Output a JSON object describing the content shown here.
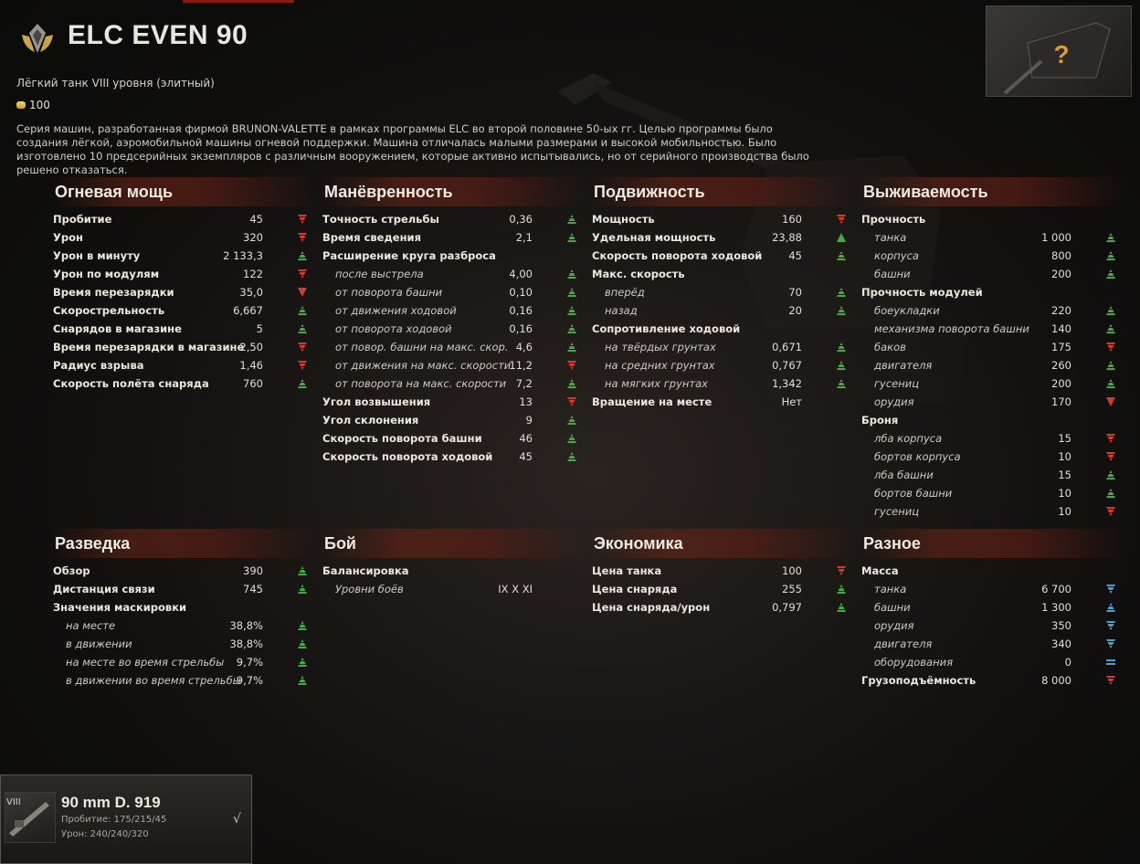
{
  "header": {
    "tank_name": "ELC EVEN 90",
    "tank_class": "Лёгкий танк VIII уровня (элитный)",
    "price": "100",
    "description": "Серия машин, разработанная фирмой BRUNON-VALETTE в рамках программы ELC во второй половине 50-ых гг. Целью программы было создания лёгкой, аэромобильной машины огневой поддержки. Машина отличалась малыми размерами и высокой мобильностью. Было изготовлено 10 предсерийных экземпляров с различным вооружением, которые активно испытывались, но от серийного производства было решено отказаться."
  },
  "sections": [
    {
      "title": "Огневая мощь",
      "rows": [
        {
          "label": "Пробитие",
          "value": "45",
          "ind": "down"
        },
        {
          "label": "Урон",
          "value": "320",
          "ind": "down"
        },
        {
          "label": "Урон в минуту",
          "value": "2 133,3",
          "ind": "up"
        },
        {
          "label": "Урон по модулям",
          "value": "122",
          "ind": "down"
        },
        {
          "label": "Время перезарядки",
          "value": "35,0",
          "ind": "downsolid"
        },
        {
          "label": "Скорострельность",
          "value": "6,667",
          "ind": "up"
        },
        {
          "label": "Снарядов в магазине",
          "value": "5",
          "ind": "up"
        },
        {
          "label": "Время перезарядки в магазине",
          "value": "2,50",
          "ind": "down"
        },
        {
          "label": "Радиус взрыва",
          "value": "1,46",
          "ind": "down"
        },
        {
          "label": "Скорость полёта снаряда",
          "value": "760",
          "ind": "up"
        }
      ]
    },
    {
      "title": "Манёвренность",
      "rows": [
        {
          "label": "Точность стрельбы",
          "value": "0,36",
          "ind": "up"
        },
        {
          "label": "Время сведения",
          "value": "2,1",
          "ind": "up"
        },
        {
          "label": "Расширение круга разброса",
          "value": "",
          "ind": ""
        },
        {
          "label": "после выстрела",
          "value": "4,00",
          "ind": "up",
          "sub": true
        },
        {
          "label": "от поворота башни",
          "value": "0,10",
          "ind": "up",
          "sub": true
        },
        {
          "label": "от движения ходовой",
          "value": "0,16",
          "ind": "up",
          "sub": true
        },
        {
          "label": "от поворота ходовой",
          "value": "0,16",
          "ind": "up",
          "sub": true
        },
        {
          "label": "от повор. башни на макс. скор.",
          "value": "4,6",
          "ind": "up",
          "sub": true
        },
        {
          "label": "от движения на макс. скорости",
          "value": "11,2",
          "ind": "down",
          "sub": true
        },
        {
          "label": "от поворота на макс. скорости",
          "value": "7,2",
          "ind": "up",
          "sub": true
        },
        {
          "label": "Угол возвышения",
          "value": "13",
          "ind": "down"
        },
        {
          "label": "Угол склонения",
          "value": "9",
          "ind": "up"
        },
        {
          "label": "Скорость поворота башни",
          "value": "46",
          "ind": "up"
        },
        {
          "label": "Скорость поворота ходовой",
          "value": "45",
          "ind": "up"
        }
      ]
    },
    {
      "title": "Подвижность",
      "rows": [
        {
          "label": "Мощность",
          "value": "160",
          "ind": "down"
        },
        {
          "label": "Удельная мощность",
          "value": "23,88",
          "ind": "upsolid"
        },
        {
          "label": "Скорость поворота ходовой",
          "value": "45",
          "ind": "up"
        },
        {
          "label": "Макс. скорость",
          "value": "",
          "ind": ""
        },
        {
          "label": "вперёд",
          "value": "70",
          "ind": "up",
          "sub": true
        },
        {
          "label": "назад",
          "value": "20",
          "ind": "up",
          "sub": true
        },
        {
          "label": "Сопротивление ходовой",
          "value": "",
          "ind": ""
        },
        {
          "label": "на твёрдых грунтах",
          "value": "0,671",
          "ind": "up",
          "sub": true
        },
        {
          "label": "на средних грунтах",
          "value": "0,767",
          "ind": "up",
          "sub": true
        },
        {
          "label": "на мягких грунтах",
          "value": "1,342",
          "ind": "up",
          "sub": true
        },
        {
          "label": "Вращение на месте",
          "value": "Нет",
          "ind": ""
        }
      ]
    },
    {
      "title": "Выживаемость",
      "rows": [
        {
          "label": "Прочность",
          "value": "",
          "ind": ""
        },
        {
          "label": "танка",
          "value": "1 000",
          "ind": "up",
          "sub": true
        },
        {
          "label": "корпуса",
          "value": "800",
          "ind": "up",
          "sub": true
        },
        {
          "label": "башни",
          "value": "200",
          "ind": "up",
          "sub": true
        },
        {
          "label": "Прочность модулей",
          "value": "",
          "ind": ""
        },
        {
          "label": "боеукладки",
          "value": "220",
          "ind": "up",
          "sub": true
        },
        {
          "label": "механизма поворота башни",
          "value": "140",
          "ind": "up",
          "sub": true
        },
        {
          "label": "баков",
          "value": "175",
          "ind": "down",
          "sub": true
        },
        {
          "label": "двигателя",
          "value": "260",
          "ind": "up",
          "sub": true
        },
        {
          "label": "гусениц",
          "value": "200",
          "ind": "up",
          "sub": true
        },
        {
          "label": "орудия",
          "value": "170",
          "ind": "downsolid",
          "sub": true
        },
        {
          "label": "Броня",
          "value": "",
          "ind": ""
        },
        {
          "label": "лба корпуса",
          "value": "15",
          "ind": "down",
          "sub": true
        },
        {
          "label": "бортов корпуса",
          "value": "10",
          "ind": "down",
          "sub": true
        },
        {
          "label": "лба башни",
          "value": "15",
          "ind": "up",
          "sub": true
        },
        {
          "label": "бортов башни",
          "value": "10",
          "ind": "up",
          "sub": true
        },
        {
          "label": "гусениц",
          "value": "10",
          "ind": "down",
          "sub": true
        }
      ]
    },
    {
      "title": "Разведка",
      "rows": [
        {
          "label": "Обзор",
          "value": "390",
          "ind": "up"
        },
        {
          "label": "Дистанция связи",
          "value": "745",
          "ind": "up"
        },
        {
          "label": "Значения маскировки",
          "value": "",
          "ind": ""
        },
        {
          "label": "на месте",
          "value": "38,8%",
          "ind": "up",
          "sub": true
        },
        {
          "label": "в движении",
          "value": "38,8%",
          "ind": "up",
          "sub": true
        },
        {
          "label": "на месте во время стрельбы",
          "value": "9,7%",
          "ind": "up",
          "sub": true
        },
        {
          "label": "в движении во время стрельбы",
          "value": "9,7%",
          "ind": "up",
          "sub": true
        }
      ]
    },
    {
      "title": "Бой",
      "rows": [
        {
          "label": "Балансировка",
          "value": "",
          "ind": ""
        },
        {
          "label": "Уровни боёв",
          "value": "IX  X  XI",
          "ind": "",
          "sub": true
        }
      ]
    },
    {
      "title": "Экономика",
      "rows": [
        {
          "label": "Цена танка",
          "value": "100",
          "ind": "down"
        },
        {
          "label": "Цена снаряда",
          "value": "255",
          "ind": "up"
        },
        {
          "label": "Цена снаряда/урон",
          "value": "0,797",
          "ind": "up"
        }
      ]
    },
    {
      "title": "Разное",
      "rows": [
        {
          "label": "Масса",
          "value": "",
          "ind": ""
        },
        {
          "label": "танка",
          "value": "6 700",
          "ind": "bdown",
          "sub": true
        },
        {
          "label": "башни",
          "value": "1 300",
          "ind": "bup",
          "sub": true
        },
        {
          "label": "орудия",
          "value": "350",
          "ind": "bdown",
          "sub": true
        },
        {
          "label": "двигателя",
          "value": "340",
          "ind": "bdown",
          "sub": true
        },
        {
          "label": "оборудования",
          "value": "0",
          "ind": "equal",
          "sub": true
        },
        {
          "label": "Грузоподъёмность",
          "value": "8 000",
          "ind": "down"
        }
      ]
    }
  ],
  "module": {
    "tier": "VIII",
    "name": "90 mm D. 919",
    "line1": "Пробитие: 175/215/45",
    "line2": "Урон: 240/240/320",
    "check": "√"
  }
}
